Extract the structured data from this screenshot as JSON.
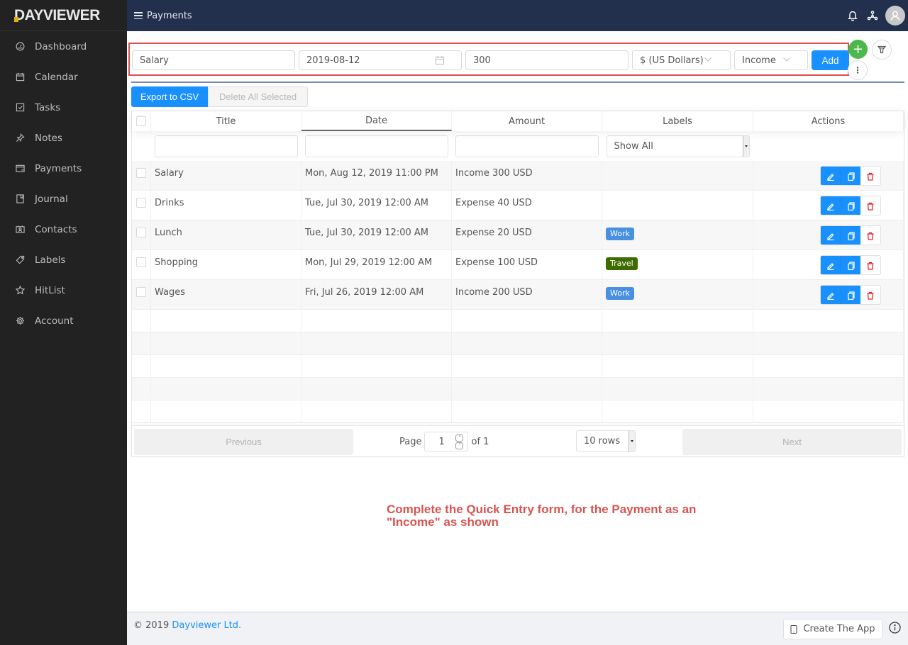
{
  "app": {
    "logo": "DAYVIEWER",
    "page_title": "Payments"
  },
  "sidebar": {
    "items": [
      {
        "label": "Dashboard",
        "icon": "dashboard-icon"
      },
      {
        "label": "Calendar",
        "icon": "calendar-icon"
      },
      {
        "label": "Tasks",
        "icon": "checkbox-icon"
      },
      {
        "label": "Notes",
        "icon": "pin-icon"
      },
      {
        "label": "Payments",
        "icon": "credit-card-icon"
      },
      {
        "label": "Journal",
        "icon": "book-icon"
      },
      {
        "label": "Contacts",
        "icon": "contacts-icon"
      },
      {
        "label": "Labels",
        "icon": "tag-icon"
      },
      {
        "label": "HitList",
        "icon": "star-icon"
      },
      {
        "label": "Account",
        "icon": "gear-icon"
      }
    ]
  },
  "quick_entry": {
    "title_value": "Salary",
    "date_value": "2019-08-12",
    "amount_value": "300",
    "currency_value": "$ (US Dollars)",
    "type_value": "Income",
    "add_label": "Add"
  },
  "toolbar": {
    "export_label": "Export to CSV",
    "delete_label": "Delete All Selected"
  },
  "table": {
    "columns": [
      "Title",
      "Date",
      "Amount",
      "Labels",
      "Actions"
    ],
    "sorted_column": "Date",
    "labels_filter": "Show All",
    "rows": [
      {
        "title": "Salary",
        "date": "Mon, Aug 12, 2019 11:00 PM",
        "amount": "Income 300 USD",
        "label": "",
        "label_color": ""
      },
      {
        "title": "Drinks",
        "date": "Tue, Jul 30, 2019 12:00 AM",
        "amount": "Expense 40 USD",
        "label": "",
        "label_color": ""
      },
      {
        "title": "Lunch",
        "date": "Tue, Jul 30, 2019 12:00 AM",
        "amount": "Expense 20 USD",
        "label": "Work",
        "label_color": "#4a90e2"
      },
      {
        "title": "Shopping",
        "date": "Mon, Jul 29, 2019 12:00 AM",
        "amount": "Expense 100 USD",
        "label": "Travel",
        "label_color": "#3e6b00"
      },
      {
        "title": "Wages",
        "date": "Fri, Jul 26, 2019 12:00 AM",
        "amount": "Income 200 USD",
        "label": "Work",
        "label_color": "#4a90e2"
      }
    ]
  },
  "pagination": {
    "previous_label": "Previous",
    "next_label": "Next",
    "page_label": "Page",
    "current_page": "1",
    "of_label": "of 1",
    "rows_per_page": "10 rows"
  },
  "instruction": "Complete the Quick Entry form, for the Payment as an \"Income\" as shown",
  "footer": {
    "copyright": "© 2019 ",
    "company": "Dayviewer Ltd.",
    "create_app_label": "Create The App"
  },
  "colors": {
    "sidebar_bg": "#222222",
    "topbar_bg": "#22304d",
    "primary": "#1890ff",
    "success": "#4cb84c",
    "highlight_border": "#d9534f",
    "logo_accent": "#e5b00b"
  }
}
